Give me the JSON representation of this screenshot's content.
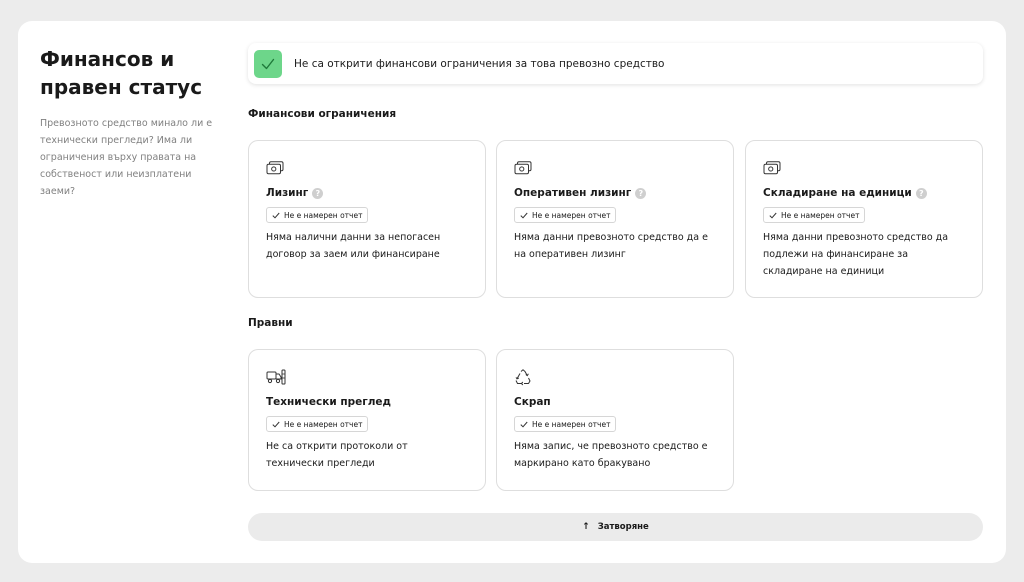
{
  "sidebar": {
    "title": "Финансов и правен статус",
    "description": "Превозното средство минало ли е технически прегледи? Има ли ограничения върху правата на собственост или неизплатени заеми?"
  },
  "banner": {
    "text": "Не са открити финансови ограничения за това превозно средство",
    "status_color": "#6dd68a"
  },
  "financial": {
    "heading": "Финансови ограничения",
    "cards": [
      {
        "title": "Лизинг",
        "icon": "money-icon",
        "badge": "Не е намерен отчет",
        "text": "Няма налични данни за непогасен договор за заем или финансиране"
      },
      {
        "title": "Оперативен лизинг",
        "icon": "money-icon",
        "badge": "Не е намерен отчет",
        "text": "Няма данни превозното средство да е на оперативен лизинг"
      },
      {
        "title": "Складиране на единици",
        "icon": "money-icon",
        "badge": "Не е намерен отчет",
        "text": "Няма данни превозното средство да подлежи на финансиране за складиране на единици"
      }
    ]
  },
  "legal": {
    "heading": "Правни",
    "cards": [
      {
        "title": "Технически преглед",
        "icon": "inspection-truck-icon",
        "badge": "Не е намерен отчет",
        "text": "Не са открити протоколи от технически прегледи"
      },
      {
        "title": "Скрап",
        "icon": "recycle-icon",
        "badge": "Не е намерен отчет",
        "text": "Няма запис, че превозното средство е маркирано като бракувано"
      }
    ]
  },
  "close_button": {
    "label": "Затворяне",
    "icon": "arrow-up-icon"
  }
}
